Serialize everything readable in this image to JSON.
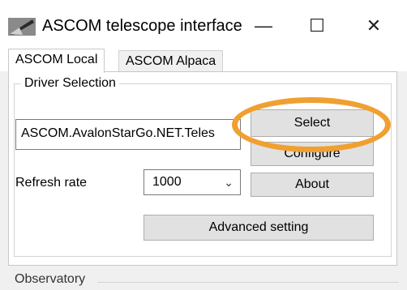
{
  "window": {
    "title": "ASCOM telescope interface",
    "icon": "telescope-app-icon",
    "controls": {
      "minimize": "—",
      "maximize": "☐",
      "close": "✕"
    }
  },
  "tabs": [
    {
      "label": "ASCOM Local",
      "active": true
    },
    {
      "label": "ASCOM Alpaca",
      "active": false
    }
  ],
  "driver_selection": {
    "legend": "Driver Selection",
    "driver_value": "ASCOM.AvalonStarGo.NET.Teles",
    "select_label": "Select",
    "configure_label": "Configure",
    "refresh_label": "Refresh rate",
    "refresh_value": "1000",
    "about_label": "About",
    "advanced_label": "Advanced setting"
  },
  "observatory": {
    "legend": "Observatory"
  },
  "colors": {
    "highlight": "#f0a030"
  }
}
